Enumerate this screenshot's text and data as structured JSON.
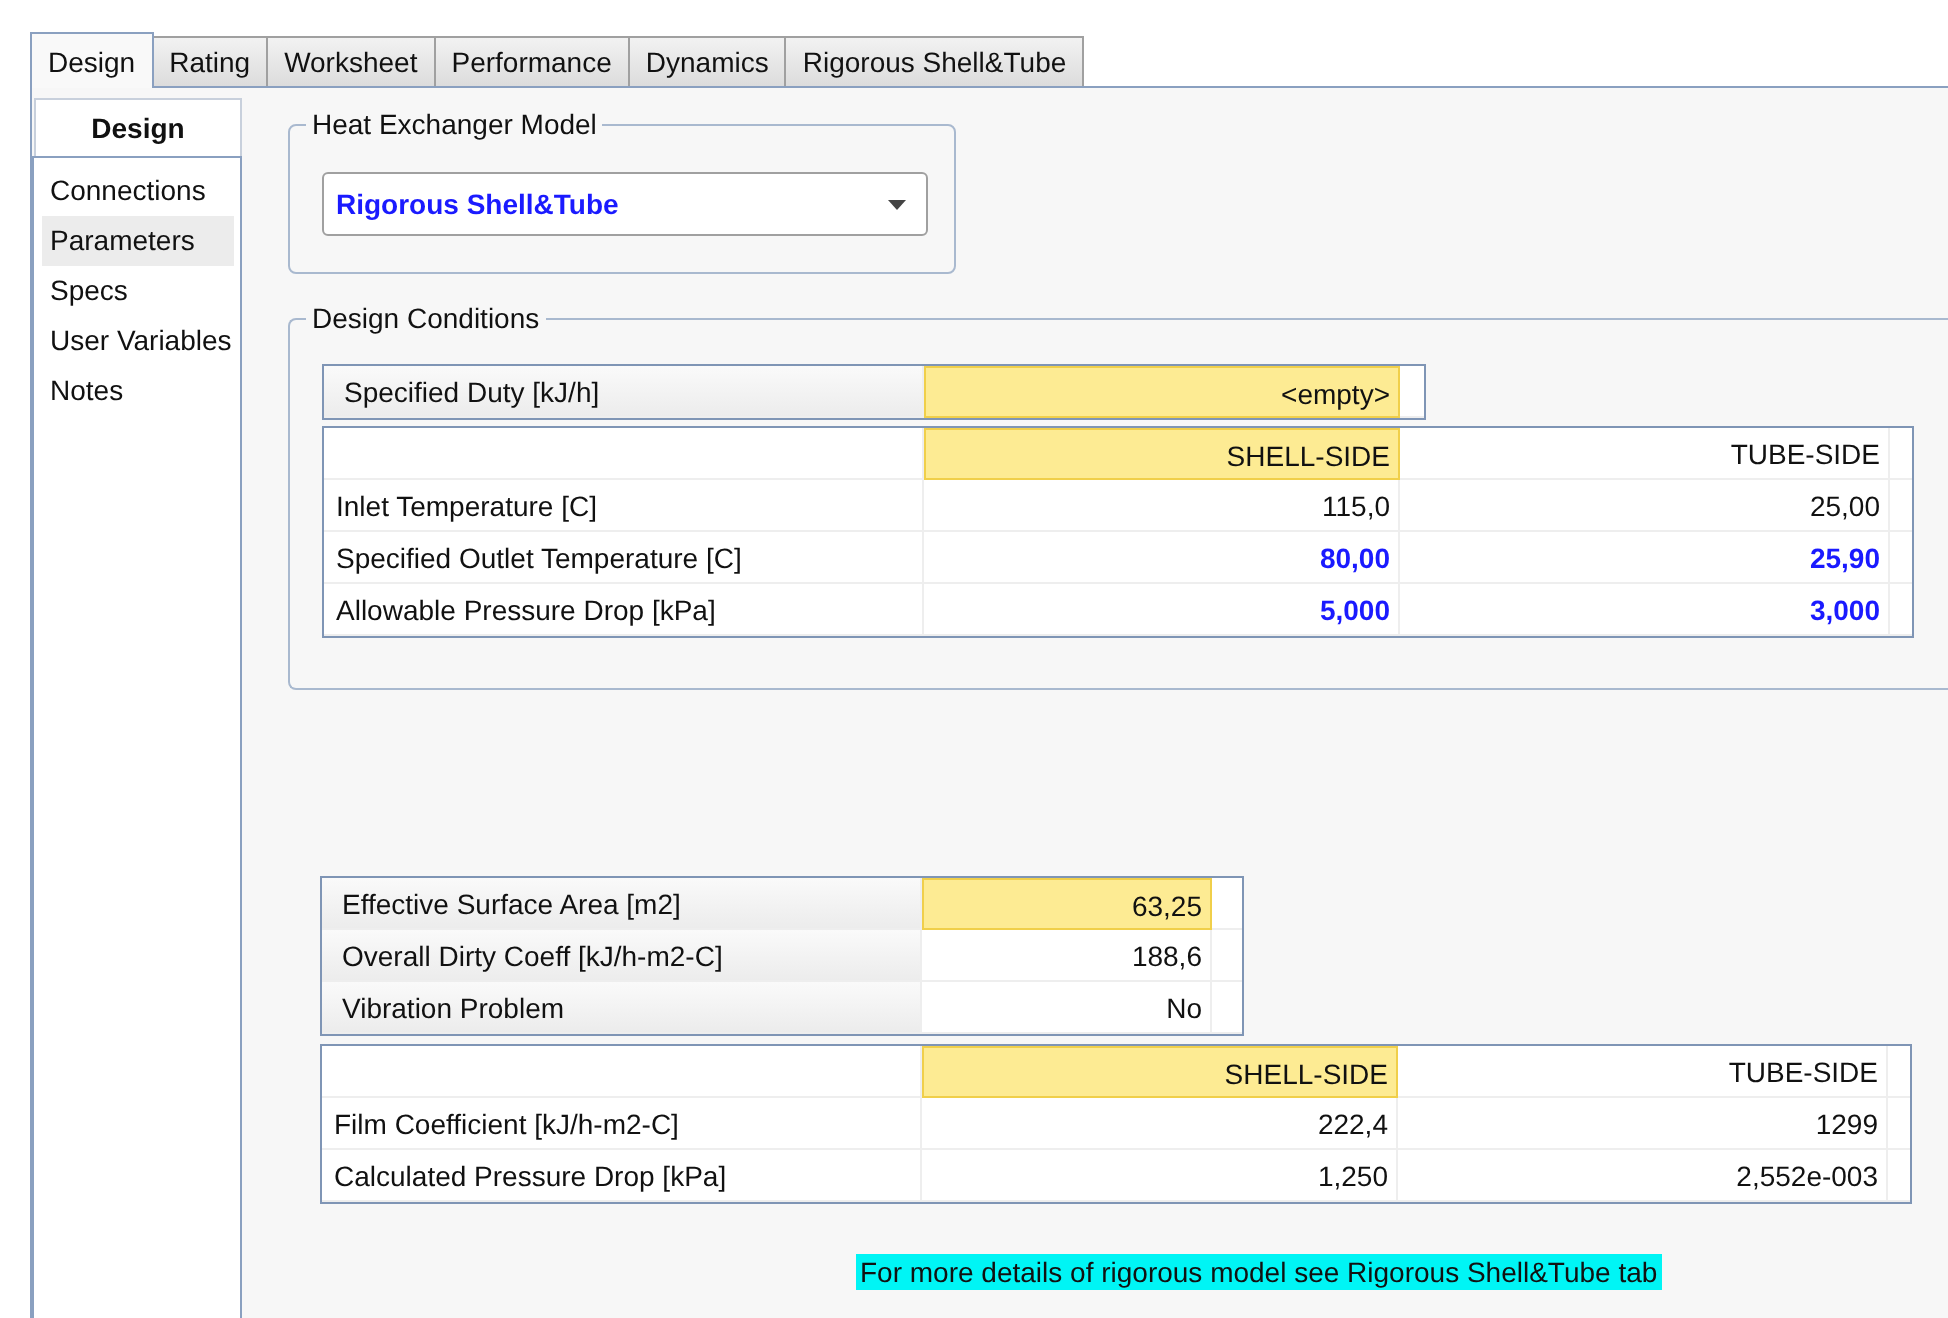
{
  "tabs": [
    {
      "label": "Design",
      "selected": true
    },
    {
      "label": "Rating",
      "selected": false
    },
    {
      "label": "Worksheet",
      "selected": false
    },
    {
      "label": "Performance",
      "selected": false
    },
    {
      "label": "Dynamics",
      "selected": false
    },
    {
      "label": "Rigorous Shell&Tube",
      "selected": false
    }
  ],
  "sidebar": {
    "title": "Design",
    "items": [
      {
        "label": "Connections",
        "selected": false
      },
      {
        "label": "Parameters",
        "selected": true
      },
      {
        "label": "Specs",
        "selected": false
      },
      {
        "label": "User Variables",
        "selected": false
      },
      {
        "label": "Notes",
        "selected": false
      }
    ]
  },
  "model_group": {
    "title": "Heat Exchanger Model",
    "dropdown": {
      "value": "Rigorous Shell&Tube"
    }
  },
  "design_conditions": {
    "title": "Design Conditions",
    "duty": {
      "label": "Specified Duty [kJ/h]",
      "value": {
        "text": "<empty>",
        "selected": true,
        "specified": false
      }
    },
    "table": {
      "columns": [
        {
          "text": "SHELL-SIDE",
          "selected": true
        },
        {
          "text": "TUBE-SIDE",
          "selected": false
        }
      ],
      "rows": [
        {
          "label": "Inlet Temperature [C]",
          "cells": [
            {
              "text": "115,0",
              "specified": false
            },
            {
              "text": "25,00",
              "specified": false
            }
          ]
        },
        {
          "label": "Specified Outlet Temperature [C]",
          "cells": [
            {
              "text": "80,00",
              "specified": true
            },
            {
              "text": "25,90",
              "specified": true
            }
          ]
        },
        {
          "label": "Allowable Pressure Drop [kPa]",
          "cells": [
            {
              "text": "5,000",
              "specified": true
            },
            {
              "text": "3,000",
              "specified": true
            }
          ]
        }
      ]
    }
  },
  "results": {
    "rows": [
      {
        "label": "Effective Surface Area [m2]",
        "value": {
          "text": "63,25",
          "selected": true,
          "specified": false
        }
      },
      {
        "label": "Overall Dirty Coeff [kJ/h-m2-C]",
        "value": {
          "text": "188,6",
          "selected": false,
          "specified": false
        }
      },
      {
        "label": "Vibration Problem",
        "value": {
          "text": "No",
          "selected": false,
          "specified": false
        }
      }
    ],
    "table": {
      "columns": [
        {
          "text": "SHELL-SIDE",
          "selected": true
        },
        {
          "text": "TUBE-SIDE",
          "selected": false
        }
      ],
      "rows": [
        {
          "label": "Film Coefficient [kJ/h-m2-C]",
          "cells": [
            {
              "text": "222,4",
              "specified": false
            },
            {
              "text": "1299",
              "specified": false
            }
          ]
        },
        {
          "label": "Calculated Pressure Drop [kPa]",
          "cells": [
            {
              "text": "1,250",
              "specified": false
            },
            {
              "text": "2,552e-003",
              "specified": false
            }
          ]
        }
      ]
    }
  },
  "note": "For more details of rigorous model see Rigorous Shell&Tube tab"
}
